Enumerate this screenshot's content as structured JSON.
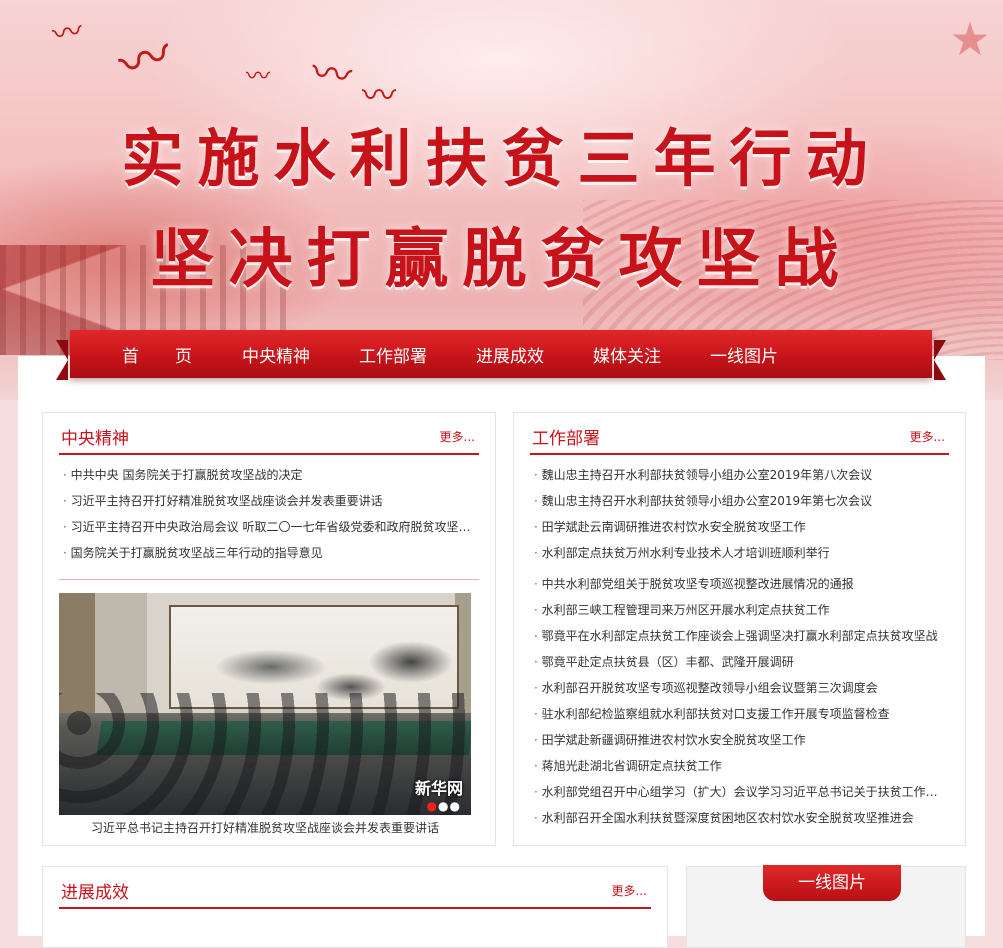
{
  "banner": {
    "line1": "实施水利扶贫三年行动",
    "line2": "坚决打赢脱贫攻坚战"
  },
  "nav": {
    "items": [
      {
        "label": "首页"
      },
      {
        "label": "中央精神"
      },
      {
        "label": "工作部署"
      },
      {
        "label": "进展成效"
      },
      {
        "label": "媒体关注"
      },
      {
        "label": "一线图片"
      }
    ]
  },
  "central": {
    "title": "中央精神",
    "more": "更多...",
    "items": [
      "中共中央 国务院关于打赢脱贫攻坚战的决定",
      "习近平主持召开打好精准脱贫攻坚战座谈会并发表重要讲话",
      "习近平主持召开中央政治局会议 听取二〇一七年省级党委和政府脱贫攻坚成效考核情况汇报",
      "国务院关于打赢脱贫攻坚战三年行动的指导意见"
    ],
    "photo_logo": "新华网",
    "photo_caption": "习近平总书记主持召开打好精准脱贫攻坚战座谈会并发表重要讲话"
  },
  "work": {
    "title": "工作部署",
    "more": "更多...",
    "group1": [
      "魏山忠主持召开水利部扶贫领导小组办公室2019年第八次会议",
      "魏山忠主持召开水利部扶贫领导小组办公室2019年第七次会议",
      "田学斌赴云南调研推进农村饮水安全脱贫攻坚工作",
      "水利部定点扶贫万州水利专业技术人才培训班顺利举行"
    ],
    "group2": [
      "中共水利部党组关于脱贫攻坚专项巡视整改进展情况的通报",
      "水利部三峡工程管理司来万州区开展水利定点扶贫工作",
      "鄂竟平在水利部定点扶贫工作座谈会上强调坚决打赢水利部定点扶贫攻坚战",
      "鄂竟平赴定点扶贫县（区）丰都、武隆开展调研",
      "水利部召开脱贫攻坚专项巡视整改领导小组会议暨第三次调度会",
      "驻水利部纪检监察组就水利部扶贫对口支援工作开展专项监督检查",
      "田学斌赴新疆调研推进农村饮水安全脱贫攻坚工作",
      "蒋旭光赴湖北省调研定点扶贫工作",
      "水利部党组召开中心组学习（扩大）会议学习习近平总书记关于扶贫工作的重要论述",
      "水利部召开全国水利扶贫暨深度贫困地区农村饮水安全脱贫攻坚推进会"
    ]
  },
  "progress": {
    "title": "进展成效",
    "more": "更多..."
  },
  "photos": {
    "title": "一线图片"
  }
}
